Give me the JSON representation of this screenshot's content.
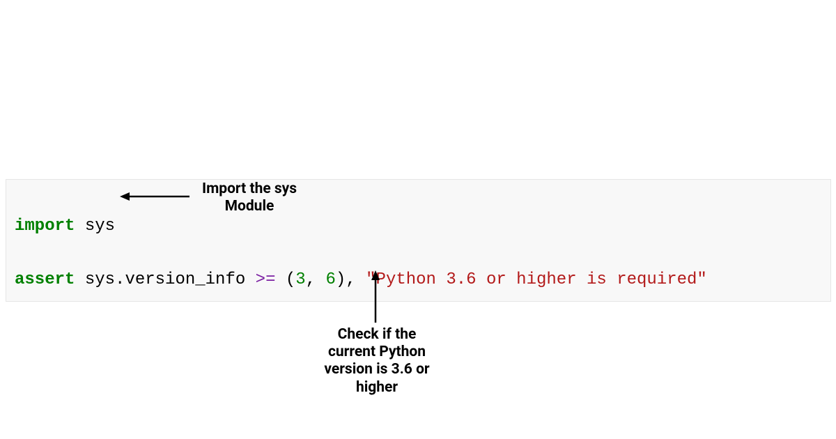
{
  "code": {
    "line1": {
      "kw": "import",
      "sp": " ",
      "mod": "sys"
    },
    "line2": {
      "kw": "assert",
      "sp1": " ",
      "expr": "sys.version_info ",
      "op": ">=",
      "sp2": " ",
      "lparen": "(",
      "n1": "3",
      "comma1": ", ",
      "n2": "6",
      "rparen": ")",
      "comma2": ", ",
      "str": "\"Python 3.6 or higher is required\""
    }
  },
  "annotations": {
    "top": {
      "l1": "Import the sys",
      "l2": "Module"
    },
    "bottom": {
      "l1": "Check if the",
      "l2": "current Python",
      "l3": "version is 3.6 or",
      "l4": "higher"
    }
  }
}
